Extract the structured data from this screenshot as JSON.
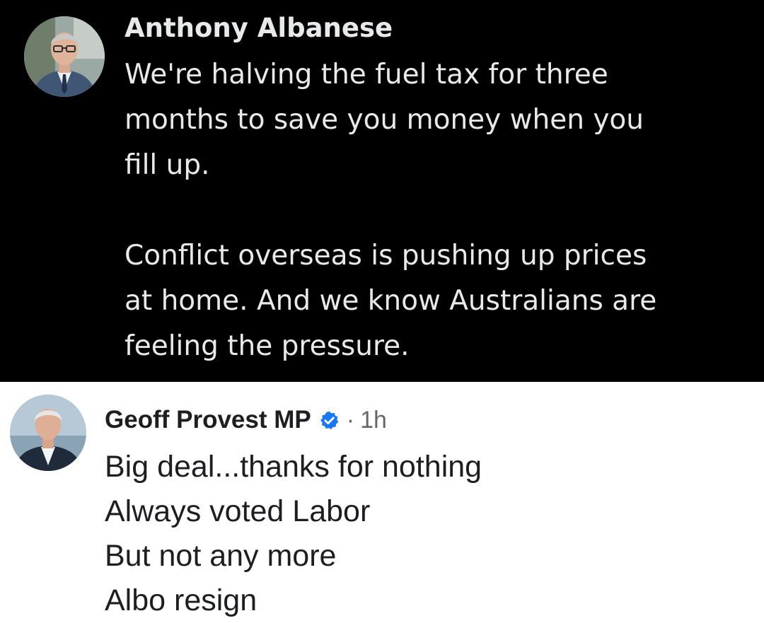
{
  "post": {
    "author": "Anthony Albanese",
    "paragraph1": [
      "We're halving the fuel tax for three",
      "months to save you money when you",
      "fill up."
    ],
    "paragraph2": [
      "Conflict overseas is pushing up prices",
      "at home. And we know Australians are",
      "feeling the pressure."
    ],
    "avatar_icon": "profile-photo",
    "background_color": "#000000",
    "text_color": "#e7e9ea"
  },
  "comment": {
    "author": "Geoff Provest MP",
    "verified_icon": "verified-badge",
    "verified_color": "#1877f2",
    "separator": "·",
    "time": "1h",
    "lines": [
      "Big deal...thanks for nothing",
      "Always voted Labor",
      "But not any more",
      "Albo resign"
    ],
    "avatar_icon": "profile-photo",
    "background_color": "#ffffff",
    "text_color": "#1c1e21"
  }
}
